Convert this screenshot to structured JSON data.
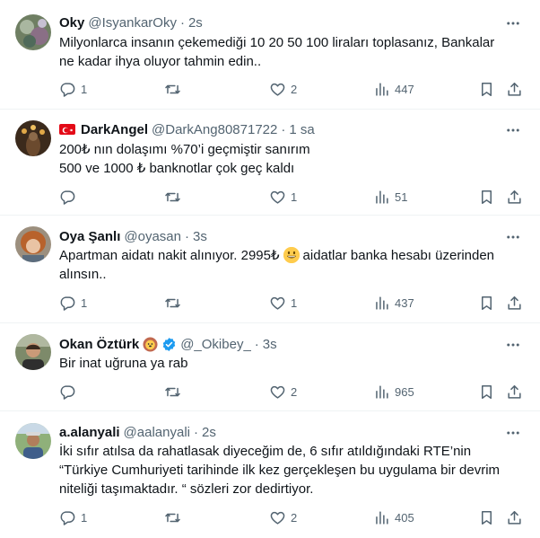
{
  "tweets": [
    {
      "name": "Oky",
      "handle": "@IsyankarOky",
      "time": "2s",
      "lines": [
        "Milyonlarca insanın çekemediği 10 20 50 100 liraları toplasanız, Bankalar",
        "ne kadar ihya oluyor tahmin edin.."
      ],
      "replies": "1",
      "retweets": "",
      "likes": "2",
      "views": "447"
    },
    {
      "name": "DarkAngel",
      "handle": "@DarkAng80871722",
      "time": "1 sa",
      "lines": [
        "200₺ nın dolaşımı %70’i geçmiştir sanırım",
        "500 ve 1000 ₺ banknotlar çok geç kaldı"
      ],
      "replies": "",
      "retweets": "",
      "likes": "1",
      "views": "51"
    },
    {
      "name": "Oya Şanlı",
      "handle": "@oyasan",
      "time": "3s",
      "line1_before": "Apartman aidatı nakit alınıyor. 2995₺",
      "line1_after": "aidatlar banka hesabı üzerinden",
      "line2": "alınsın..",
      "replies": "1",
      "retweets": "",
      "likes": "1",
      "views": "437"
    },
    {
      "name": "Okan Öztürk",
      "handle": "@_Okibey_",
      "time": "3s",
      "lines": [
        "Bir inat uğruna ya rab"
      ],
      "replies": "",
      "retweets": "",
      "likes": "2",
      "views": "965"
    },
    {
      "name": "a.alanyali",
      "handle": "@aalanyali",
      "time": "2s",
      "lines": [
        "İki sıfır atılsa da rahatlasak diyeceğim de, 6 sıfır atıldığındaki RTE’nin",
        "“Türkiye Cumhuriyeti tarihinde ilk kez gerçekleşen bu uygulama bir devrim",
        "niteliği taşımaktadır. “ sözleri zor dedirtiyor."
      ],
      "replies": "1",
      "retweets": "",
      "likes": "2",
      "views": "405"
    }
  ],
  "separator": "·",
  "icons": [
    "more-icon",
    "reply-icon",
    "retweet-icon",
    "like-icon",
    "views-icon",
    "bookmark-icon",
    "share-icon",
    "turkey-flag-icon",
    "verified-icon",
    "lion-emoji-icon",
    "grinning-emoji-icon"
  ],
  "colors": {
    "text": "#0f1419",
    "secondary": "#536471",
    "verified": "#1d9bf0",
    "flag": "#e30a17",
    "border": "#eff3f4"
  }
}
